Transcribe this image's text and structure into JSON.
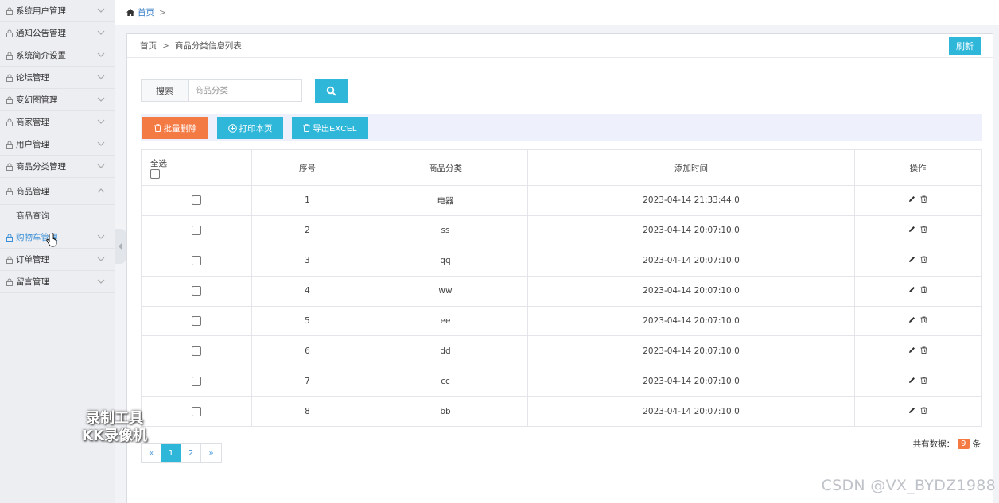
{
  "sidebar": {
    "items": [
      {
        "label": "系统用户管理",
        "expanded": false
      },
      {
        "label": "通知公告管理",
        "expanded": false
      },
      {
        "label": "系统简介设置",
        "expanded": false
      },
      {
        "label": "论坛管理",
        "expanded": false
      },
      {
        "label": "变幻图管理",
        "expanded": false
      },
      {
        "label": "商家管理",
        "expanded": false
      },
      {
        "label": "用户管理",
        "expanded": false
      },
      {
        "label": "商品分类管理",
        "expanded": false
      },
      {
        "label": "商品管理",
        "expanded": true
      },
      {
        "label": "购物车管理",
        "expanded": false,
        "hover": true
      },
      {
        "label": "订单管理",
        "expanded": false
      },
      {
        "label": "留言管理",
        "expanded": false
      }
    ],
    "sub_item": "商品查询"
  },
  "topbar": {
    "home": "首页",
    "sep": ">"
  },
  "panel": {
    "breadcrumb_home": "首页",
    "breadcrumb_sep": ">",
    "breadcrumb_current": "商品分类信息列表",
    "refresh": "刷新"
  },
  "search": {
    "label": "搜索",
    "placeholder": "商品分类",
    "value": ""
  },
  "toolbar": {
    "batch_delete": "批量删除",
    "print_page": "打印本页",
    "export_excel": "导出EXCEL"
  },
  "table": {
    "select_all": "全选",
    "headers": [
      "序号",
      "商品分类",
      "添加时间",
      "操作"
    ],
    "rows": [
      {
        "index": "1",
        "category": "电器",
        "time": "2023-04-14 21:33:44.0"
      },
      {
        "index": "2",
        "category": "ss",
        "time": "2023-04-14 20:07:10.0"
      },
      {
        "index": "3",
        "category": "qq",
        "time": "2023-04-14 20:07:10.0"
      },
      {
        "index": "4",
        "category": "ww",
        "time": "2023-04-14 20:07:10.0"
      },
      {
        "index": "5",
        "category": "ee",
        "time": "2023-04-14 20:07:10.0"
      },
      {
        "index": "6",
        "category": "dd",
        "time": "2023-04-14 20:07:10.0"
      },
      {
        "index": "7",
        "category": "cc",
        "time": "2023-04-14 20:07:10.0"
      },
      {
        "index": "8",
        "category": "bb",
        "time": "2023-04-14 20:07:10.0"
      }
    ]
  },
  "pager": {
    "prev": "«",
    "pages": [
      "1",
      "2"
    ],
    "current": "1",
    "next": "»"
  },
  "total": {
    "prefix": "共有数据：",
    "count": "9",
    "suffix": "条"
  },
  "watermark": {
    "line1": "录制工具",
    "line2": "KK录像机"
  },
  "csdn": "CSDN @VX_BYDZ1988",
  "colors": {
    "accent": "#2fb7da",
    "danger": "#f47a44",
    "link": "#3b8fd6"
  }
}
